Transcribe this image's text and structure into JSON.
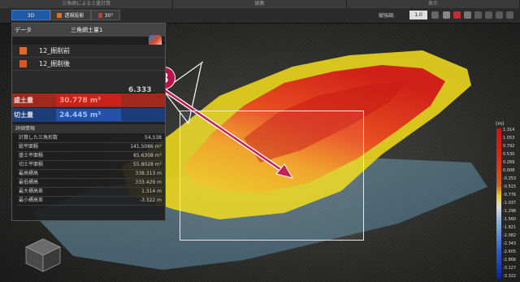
{
  "title_strip": [
    "三角網による土量計算",
    "編集",
    "表示"
  ],
  "toolbar": {
    "mode_3d": "3D",
    "perspective": "透視投影",
    "angle": "30°",
    "vertical_exaggeration_label": "縦強調:",
    "vertical_exaggeration_value": "1.0"
  },
  "panel": {
    "header_key": "データ",
    "header_value": "三角網土量1",
    "layers": [
      {
        "name": "12_掘削前",
        "color": "#e06a2a"
      },
      {
        "name": "12_掘削後",
        "color": "#d8552a"
      }
    ],
    "fill": {
      "label": "盛土量",
      "value": "30.778 m³"
    },
    "cut": {
      "label": "切土量",
      "value": "24.445 m³"
    },
    "extra_value": "6.333",
    "details_header": "詳細情報",
    "stats": [
      {
        "label": "計算した三角形数",
        "value": "54,538"
      },
      {
        "label": "総平面積",
        "value": "141.5086 m²"
      },
      {
        "label": "盛土平面積",
        "value": "85.6308 m²"
      },
      {
        "label": "切土平面積",
        "value": "55.8028 m²"
      },
      {
        "label": "最高標高",
        "value": "338.313 m"
      },
      {
        "label": "最低標高",
        "value": "333.429 m"
      },
      {
        "label": "最大標高差",
        "value": "1.314 m"
      },
      {
        "label": "最小標高差",
        "value": "-3.322 m"
      }
    ]
  },
  "annotation": {
    "step_number": "3"
  },
  "legend": {
    "unit": "(m)",
    "ticks": [
      "1.314",
      "1.053",
      "0.792",
      "0.530",
      "0.269",
      "0.008",
      "-0.253",
      "-0.515",
      "-0.776",
      "-1.037",
      "-1.298",
      "-1.560",
      "-1.821",
      "-2.082",
      "-2.343",
      "-2.605",
      "-2.866",
      "-3.127",
      "-3.322"
    ]
  },
  "colors": {
    "fill_red": "#c8221a",
    "cut_blue": "#2552a8",
    "badge": "#b8124a",
    "arrow": "#c0134e",
    "toolbar_active": "#1e5aa8"
  }
}
